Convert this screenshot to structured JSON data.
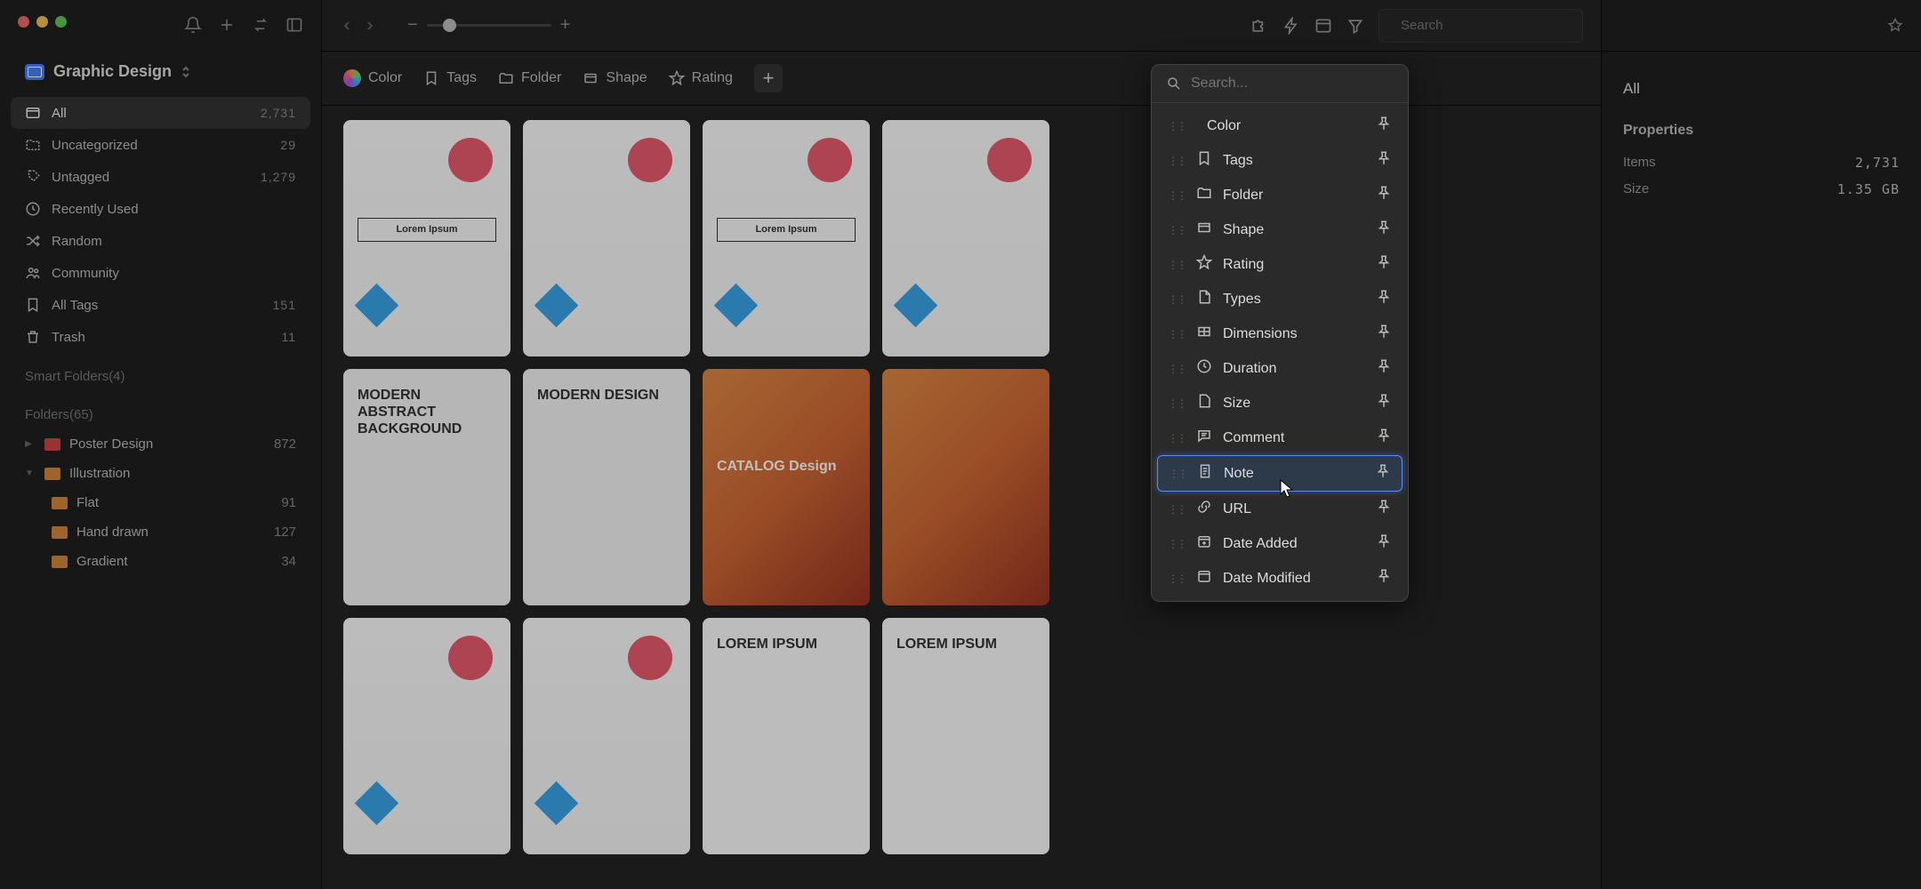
{
  "library": {
    "name": "Graphic Design"
  },
  "sidebar": {
    "nav": [
      {
        "key": "all",
        "label": "All",
        "count": "2,731",
        "active": true,
        "icon": "collection"
      },
      {
        "key": "uncategorized",
        "label": "Uncategorized",
        "count": "29",
        "icon": "folder-dashed"
      },
      {
        "key": "untagged",
        "label": "Untagged",
        "count": "1,279",
        "icon": "tag-dashed"
      },
      {
        "key": "recently",
        "label": "Recently Used",
        "count": "",
        "icon": "clock"
      },
      {
        "key": "random",
        "label": "Random",
        "count": "",
        "icon": "shuffle"
      },
      {
        "key": "community",
        "label": "Community",
        "count": "",
        "icon": "users"
      },
      {
        "key": "alltags",
        "label": "All Tags",
        "count": "151",
        "icon": "bookmark"
      },
      {
        "key": "trash",
        "label": "Trash",
        "count": "11",
        "icon": "trash"
      }
    ],
    "smart_folders_label": "Smart Folders(4)",
    "folders_label": "Folders(65)",
    "folders": [
      {
        "label": "Poster Design",
        "count": "872",
        "color": "red",
        "expanded": false
      },
      {
        "label": "Illustration",
        "count": "",
        "color": "orange",
        "expanded": true,
        "children": [
          {
            "label": "Flat",
            "count": "91"
          },
          {
            "label": "Hand drawn",
            "count": "127"
          },
          {
            "label": "Gradient",
            "count": "34"
          }
        ]
      }
    ]
  },
  "topbar": {
    "search_placeholder": "Search"
  },
  "filters": {
    "pinned": [
      {
        "key": "color",
        "label": "Color"
      },
      {
        "key": "tags",
        "label": "Tags"
      },
      {
        "key": "folder",
        "label": "Folder"
      },
      {
        "key": "shape",
        "label": "Shape"
      },
      {
        "key": "rating",
        "label": "Rating"
      }
    ]
  },
  "dropdown": {
    "search_placeholder": "Search...",
    "items": [
      {
        "key": "color",
        "label": "Color",
        "pinned": true
      },
      {
        "key": "tags",
        "label": "Tags",
        "pinned": true
      },
      {
        "key": "folder",
        "label": "Folder",
        "pinned": true
      },
      {
        "key": "shape",
        "label": "Shape",
        "pinned": true
      },
      {
        "key": "rating",
        "label": "Rating",
        "pinned": true
      },
      {
        "key": "types",
        "label": "Types",
        "pinned": false
      },
      {
        "key": "dimensions",
        "label": "Dimensions",
        "pinned": false
      },
      {
        "key": "duration",
        "label": "Duration",
        "pinned": false
      },
      {
        "key": "size",
        "label": "Size",
        "pinned": false
      },
      {
        "key": "comment",
        "label": "Comment",
        "pinned": false
      },
      {
        "key": "note",
        "label": "Note",
        "pinned": false,
        "highlighted": true
      },
      {
        "key": "url",
        "label": "URL",
        "pinned": false
      },
      {
        "key": "date_added",
        "label": "Date Added",
        "pinned": false
      },
      {
        "key": "date_modified",
        "label": "Date Modified",
        "pinned": false
      }
    ]
  },
  "right_panel": {
    "title": "All",
    "properties_heading": "Properties",
    "rows": [
      {
        "label": "Items",
        "value": "2,731"
      },
      {
        "label": "Size",
        "value": "1.35 GB"
      }
    ]
  },
  "thumbnails": [
    {
      "type": "memphis",
      "label": "Lorem Ipsum"
    },
    {
      "type": "memphis",
      "label": ""
    },
    {
      "type": "memphis",
      "label": "Lorem Ipsum"
    },
    {
      "type": "memphis",
      "label": ""
    },
    {
      "type": "modern",
      "label": "MODERN ABSTRACT BACKGROUND"
    },
    {
      "type": "modern",
      "label": "MODERN DESIGN"
    },
    {
      "type": "abstract",
      "label": "CATALOG Design"
    },
    {
      "type": "abstract",
      "label": ""
    },
    {
      "type": "memphis",
      "label": ""
    },
    {
      "type": "memphis",
      "label": ""
    },
    {
      "type": "lorem",
      "label": "LOREM IPSUM"
    },
    {
      "type": "lorem",
      "label": "LOREM IPSUM"
    }
  ]
}
